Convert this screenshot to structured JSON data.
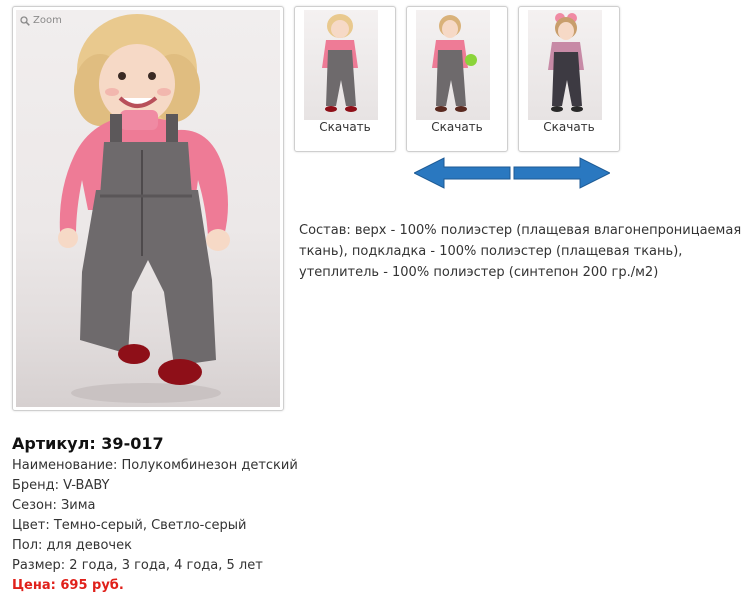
{
  "main_image": {
    "zoom_label": "Zoom"
  },
  "thumbnails": [
    {
      "download_label": "Скачать"
    },
    {
      "download_label": "Скачать"
    },
    {
      "download_label": "Скачать"
    }
  ],
  "description": "Состав: верх - 100% полиэстер (плащевая влагонепроницаемая ткань), подкладка - 100% полиэстер (плащевая ткань), утеплитель - 100% полиэстер (синтепон 200 гр./м2)",
  "product": {
    "sku": "Артикул: 39-017",
    "name": "Наименование: Полукомбинезон детский",
    "brand": "Бренд: V-BABY",
    "season": "Сезон: Зима",
    "color": "Цвет: Темно-серый, Светло-серый",
    "gender": "Пол: для девочек",
    "sizes": "Размер: 2 года, 3 года, 4 года, 5 лет",
    "price": "Цена: 695 руб."
  },
  "colors": {
    "price": "#e0201a",
    "arrow": "#2a78c0",
    "pants": "#6e6a6c",
    "shirt": "#ee7b96"
  }
}
